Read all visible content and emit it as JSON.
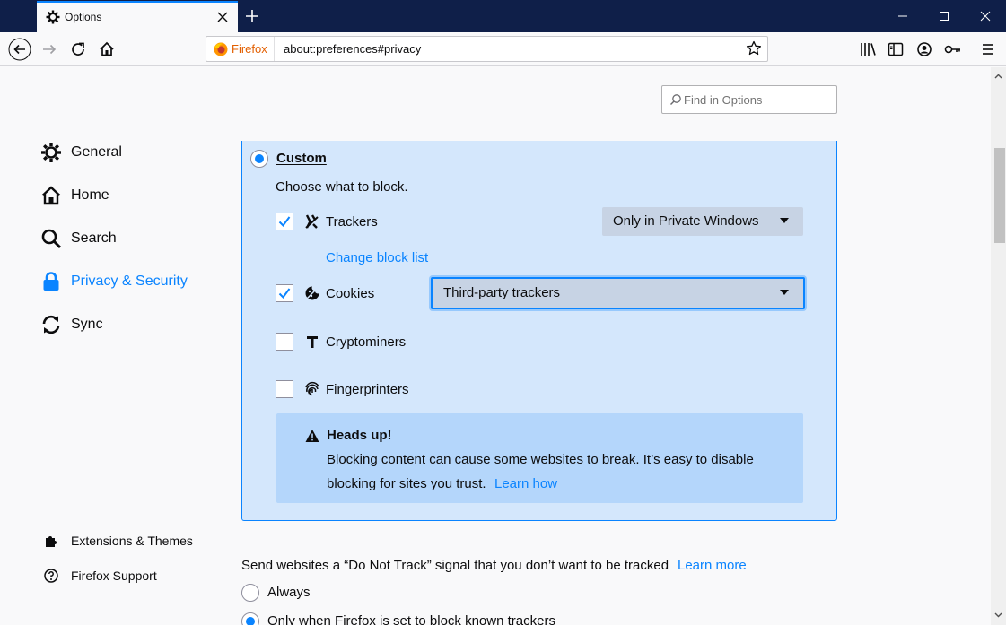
{
  "tab": {
    "title": "Options"
  },
  "urlbar": {
    "identity_label": "Firefox",
    "url": "about:preferences#privacy"
  },
  "search": {
    "placeholder": "Find in Options"
  },
  "sidebar": {
    "items": [
      {
        "label": "General",
        "icon": "gear-icon"
      },
      {
        "label": "Home",
        "icon": "home-icon"
      },
      {
        "label": "Search",
        "icon": "search-icon"
      },
      {
        "label": "Privacy & Security",
        "icon": "lock-icon",
        "selected": true
      },
      {
        "label": "Sync",
        "icon": "sync-icon"
      }
    ],
    "footer": [
      {
        "label": "Extensions & Themes",
        "icon": "puzzle-icon"
      },
      {
        "label": "Firefox Support",
        "icon": "help-icon"
      }
    ]
  },
  "custom": {
    "title": "Custom",
    "subtitle": "Choose what to block.",
    "trackers": {
      "label": "Trackers",
      "checked": true,
      "option": "Only in Private Windows",
      "link": "Change block list"
    },
    "cookies": {
      "label": "Cookies",
      "checked": true,
      "option": "Third-party trackers"
    },
    "cryptominers": {
      "label": "Cryptominers",
      "checked": false
    },
    "fingerprinters": {
      "label": "Fingerprinters",
      "checked": false
    },
    "warning": {
      "title": "Heads up!",
      "line1": "Blocking content can cause some websites to break. It’s easy to disable",
      "line2": "blocking for sites you trust.",
      "link": "Learn how"
    }
  },
  "dnt": {
    "text": "Send websites a “Do Not Track” signal that you don’t want to be tracked",
    "link": "Learn more",
    "options": [
      {
        "label": "Always",
        "checked": false
      },
      {
        "label": "Only when Firefox is set to block known trackers",
        "checked": true
      }
    ]
  },
  "colors": {
    "accent": "#0a84ff",
    "titlebar": "#0f1f49",
    "custom_bg": "#d4e7fc",
    "warning_bg": "#b4d6fb"
  }
}
